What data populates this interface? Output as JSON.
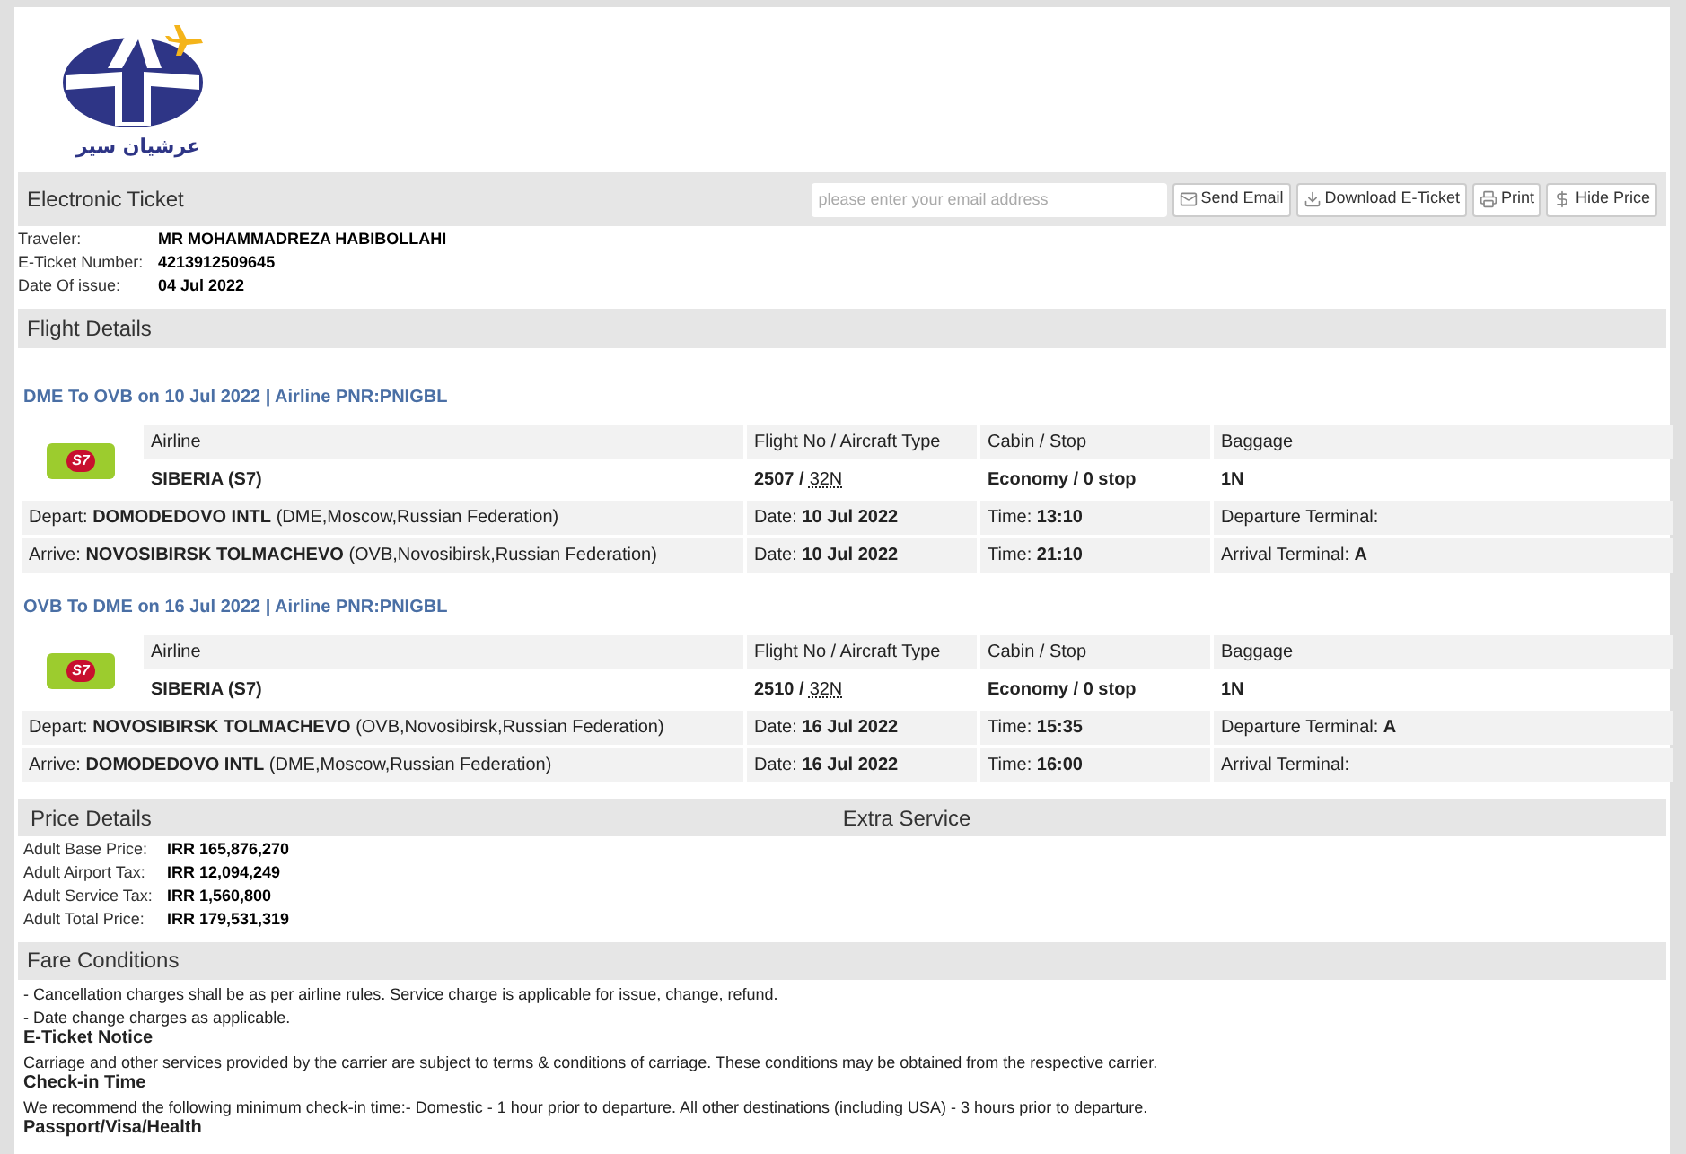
{
  "logo": {
    "text": "عرشیان سیر"
  },
  "header": {
    "title": "Electronic Ticket",
    "email_field": {
      "placeholder": "please enter your email address"
    },
    "buttons": [
      {
        "kind": "email",
        "label": "Send Email"
      },
      {
        "kind": "download",
        "label": "Download E-Ticket"
      },
      {
        "kind": "print",
        "label": "Print"
      },
      {
        "kind": "price",
        "label": "Hide Price"
      }
    ]
  },
  "info": [
    {
      "label": "Traveler:",
      "value": "MR MOHAMMADREZA HABIBOLLAHI"
    },
    {
      "label": "E-Ticket Number:",
      "value": "4213912509645"
    },
    {
      "label": "Date Of issue:",
      "value": "04 Jul 2022"
    }
  ],
  "flight_details": {
    "title": "Flight Details",
    "segments": [
      {
        "title": "DME To OVB on 10 Jul 2022 | Airline PNR:PNIGBL",
        "logo": "S7",
        "headers": [
          "Airline",
          "Flight No / Aircraft Type",
          "Cabin / Stop",
          "Baggage"
        ],
        "airline": "SIBERIA (S7)",
        "flight_no": "2507 /",
        "aircraft": "32N",
        "cabin": "Economy / 0 stop",
        "baggage": "1N",
        "rows": [
          [
            {
              "label": "Depart:",
              "value": "DOMODEDOVO INTL",
              "extra": "(DME,Moscow,Russian Federation)"
            },
            {
              "label": "Date:",
              "value": "10 Jul 2022"
            },
            {
              "label": "Time:",
              "value": "13:10"
            },
            {
              "label": "Departure Terminal:"
            }
          ],
          [
            {
              "label": "Arrive:",
              "value": "NOVOSIBIRSK TOLMACHEVO",
              "extra": "(OVB,Novosibirsk,Russian Federation)"
            },
            {
              "label": "Date:",
              "value": "10 Jul 2022"
            },
            {
              "label": "Time:",
              "value": "21:10"
            },
            {
              "label": "Arrival Terminal:",
              "value": "A"
            }
          ]
        ]
      },
      {
        "title": "OVB To DME on 16 Jul 2022 | Airline PNR:PNIGBL",
        "logo": "S7",
        "headers": [
          "Airline",
          "Flight No / Aircraft Type",
          "Cabin / Stop",
          "Baggage"
        ],
        "airline": "SIBERIA (S7)",
        "flight_no": "2510 /",
        "aircraft": "32N",
        "cabin": "Economy / 0 stop",
        "baggage": "1N",
        "rows": [
          [
            {
              "label": "Depart:",
              "value": "NOVOSIBIRSK TOLMACHEVO",
              "extra": "(OVB,Novosibirsk,Russian Federation)"
            },
            {
              "label": "Date:",
              "value": "16 Jul 2022"
            },
            {
              "label": "Time:",
              "value": "15:35"
            },
            {
              "label": "Departure Terminal:",
              "value": "A"
            }
          ],
          [
            {
              "label": "Arrive:",
              "value": "DOMODEDOVO INTL",
              "extra": "(DME,Moscow,Russian Federation)"
            },
            {
              "label": "Date:",
              "value": "16 Jul 2022"
            },
            {
              "label": "Time:",
              "value": "16:00"
            },
            {
              "label": "Arrival Terminal:"
            }
          ]
        ]
      }
    ]
  },
  "price_details": {
    "title": "Price Details",
    "extra_title": "Extra Service",
    "rows": [
      {
        "label": "Adult Base Price:",
        "value": "IRR 165,876,270"
      },
      {
        "label": "Adult Airport Tax:",
        "value": "IRR 12,094,249"
      },
      {
        "label": "Adult Service Tax:",
        "value": "IRR 1,560,800"
      },
      {
        "label": "Adult Total Price:",
        "value": "IRR 179,531,319"
      }
    ]
  },
  "fare_conditions": {
    "title": "Fare Conditions",
    "lines": [
      {
        "kind": "text",
        "text": "- Cancellation charges shall be as per airline rules. Service charge is applicable for issue, change, refund."
      },
      {
        "kind": "text",
        "text": "- Date change charges as applicable."
      },
      {
        "kind": "heading",
        "text": "E-Ticket Notice"
      },
      {
        "kind": "text",
        "text": "Carriage and other services provided by the carrier are subject to terms & conditions of carriage. These conditions may be obtained from the respective carrier."
      },
      {
        "kind": "heading",
        "text": "Check-in Time"
      },
      {
        "kind": "text",
        "text": "We recommend the following minimum check-in time:- Domestic - 1 hour prior to departure. All other destinations (including USA) - 3 hours prior to departure."
      },
      {
        "kind": "heading",
        "text": "Passport/Visa/Health"
      }
    ]
  }
}
